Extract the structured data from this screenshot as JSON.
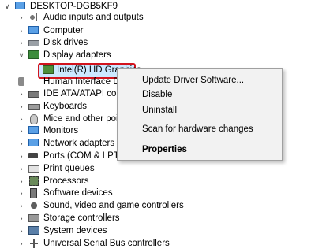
{
  "tree": {
    "root": "DESKTOP-DGB5KF9",
    "items": [
      {
        "label": "Audio inputs and outputs",
        "icon": "speaker-icon"
      },
      {
        "label": "Computer",
        "icon": "computer-icon"
      },
      {
        "label": "Disk drives",
        "icon": "disk-drive-icon"
      },
      {
        "label": "Display adapters",
        "icon": "display-adapter-icon"
      },
      {
        "label": "Intel(R) HD Graphics",
        "icon": "gpu-icon"
      },
      {
        "label": "Human Interface De",
        "icon": "hid-icon"
      },
      {
        "label": "IDE ATA/ATAPI cont",
        "icon": "ide-controller-icon"
      },
      {
        "label": "Keyboards",
        "icon": "keyboard-icon"
      },
      {
        "label": "Mice and other poin",
        "icon": "mouse-icon"
      },
      {
        "label": "Monitors",
        "icon": "monitor-icon"
      },
      {
        "label": "Network adapters",
        "icon": "network-adapter-icon"
      },
      {
        "label": "Ports (COM & LPT)",
        "icon": "port-icon"
      },
      {
        "label": "Print queues",
        "icon": "printer-icon"
      },
      {
        "label": "Processors",
        "icon": "processor-icon"
      },
      {
        "label": "Software devices",
        "icon": "software-device-icon"
      },
      {
        "label": "Sound, video and game controllers",
        "icon": "sound-icon"
      },
      {
        "label": "Storage controllers",
        "icon": "storage-controller-icon"
      },
      {
        "label": "System devices",
        "icon": "system-device-icon"
      },
      {
        "label": "Universal Serial Bus controllers",
        "icon": "usb-icon"
      }
    ]
  },
  "context_menu": {
    "update": "Update Driver Software...",
    "disable": "Disable",
    "uninstall": "Uninstall",
    "scan": "Scan for hardware changes",
    "properties": "Properties"
  },
  "colors": {
    "highlight_border": "#d2141e",
    "selection_bg": "#cce8ff"
  }
}
